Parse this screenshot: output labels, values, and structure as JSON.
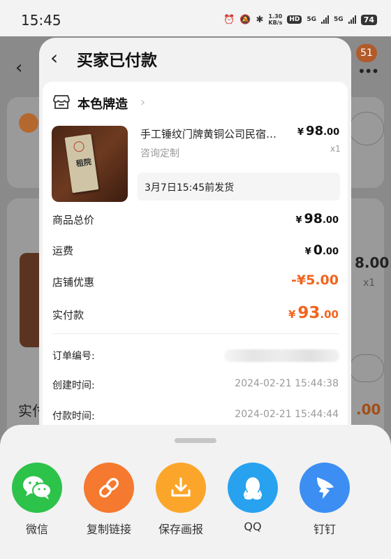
{
  "status_bar": {
    "time": "15:45",
    "net_speed_value": "1.30",
    "net_speed_unit": "KB/s",
    "hd_label": "HD",
    "network_5g_1": "5G",
    "network_5g_2": "5G",
    "battery": "74"
  },
  "background": {
    "notification_count": "51",
    "product_price_partial": "8.00",
    "qty_partial": "x1",
    "pay_label_partial": "实付",
    "pay_amount_partial": ".00"
  },
  "modal": {
    "title": "买家已付款",
    "shop_name": "本色牌造",
    "product": {
      "title": "手工锤纹门牌黄铜公司民宿…",
      "spec": "咨询定制",
      "price_yen": "¥",
      "price_int": "98",
      "price_dec": ".00",
      "quantity": "x1",
      "shipping_note": "3月7日15:45前发货",
      "plaque_text": "租院"
    },
    "summary": [
      {
        "label": "商品总价",
        "yen": "¥",
        "int": "98",
        "dec": ".00"
      },
      {
        "label": "运费",
        "yen": "¥",
        "int": "0",
        "dec": ".00"
      },
      {
        "label": "店铺优惠",
        "text": "-¥5.00"
      },
      {
        "label": "实付款",
        "yen": "¥",
        "int": "93",
        "dec": ".00"
      }
    ],
    "info": [
      {
        "label": "订单编号:",
        "value": ""
      },
      {
        "label": "创建时间:",
        "value": "2024-02-21 15:44:38"
      },
      {
        "label": "付款时间:",
        "value": "2024-02-21 15:44:44"
      }
    ]
  },
  "share": {
    "items": [
      {
        "label": "微信",
        "icon": "wechat-icon",
        "color": "#2dc24a"
      },
      {
        "label": "复制链接",
        "icon": "link-icon",
        "color": "#f5792f"
      },
      {
        "label": "保存画报",
        "icon": "download-icon",
        "color": "#fba62a"
      },
      {
        "label": "QQ",
        "icon": "qq-icon",
        "color": "#28a2ef"
      },
      {
        "label": "钉钉",
        "icon": "dingtalk-icon",
        "color": "#3c8ef2"
      }
    ]
  },
  "colors": {
    "accent_orange": "#f2641e",
    "card_bg": "#ffffff",
    "sheet_bg": "#f2f2f2"
  }
}
